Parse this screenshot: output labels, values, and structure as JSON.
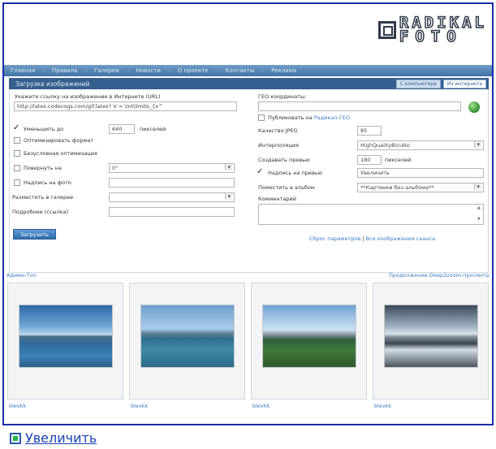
{
  "logo": {
    "line1": "RADIKAL",
    "line2": "FOTO"
  },
  "nav": [
    "Главная",
    "Правила",
    "Галереи",
    "Новости",
    "О проекте",
    "Контакты",
    "Реклама"
  ],
  "panel": {
    "title": "Загрузка изображений",
    "tabs": [
      "С компьютера",
      "Из интернета"
    ],
    "active_tab": "Из интернета"
  },
  "form_left": {
    "url_label": "Укажите ссылку на изображение в Интернете (URL)",
    "url_value": "http://latex.codecogs.com/gif.latex? V = \\int\\limits_{x^",
    "reduce_label": "Уменьшить до",
    "reduce_value": "640",
    "reduce_unit": "пикселей",
    "optimize_format": "Оптимизировать формат",
    "unconditional_opt": "Безусловная оптимизация",
    "rotate_label": "Повернуть на",
    "rotate_value": "0°",
    "caption_label": "Надпись на фото",
    "gallery_label": "Разместить в галерее",
    "more_label": "Подробнее (ссылка)",
    "submit": "Загрузить"
  },
  "form_right": {
    "geo_label": "ГЕО координаты:",
    "publish_label": "Публиковать на",
    "publish_link": "Радикал-ГЕО",
    "jpeg_label": "Качество JPEG",
    "jpeg_value": "85",
    "interp_label": "Интерполяция",
    "interp_value": "HighQualityBicubic",
    "preview_label": "Создавать превью",
    "preview_value": "180",
    "preview_unit": "пикселей",
    "preview_caption_label": "Надпись на превью",
    "preview_caption_value": "Увеличить",
    "album_label": "Поместить в альбом",
    "album_value": "**Картинки без альбома**",
    "comment_label": "Комментарий",
    "reset_link": "Сброс параметров",
    "separator": "|",
    "all_link": "Все изображения сеанса"
  },
  "gallery": {
    "left": "Админ-Топ",
    "right_links": [
      "Продолжение",
      "Deep2zoom-просмотр"
    ],
    "captions": [
      "blevkk",
      "blevkk",
      "blevkk",
      "blevkk"
    ]
  },
  "zoom_link": "Увеличить",
  "colors": {
    "frame": "#1a2db0",
    "nav": "#3f74a6",
    "panel": "#345f8e",
    "link": "#3a7bc3"
  }
}
